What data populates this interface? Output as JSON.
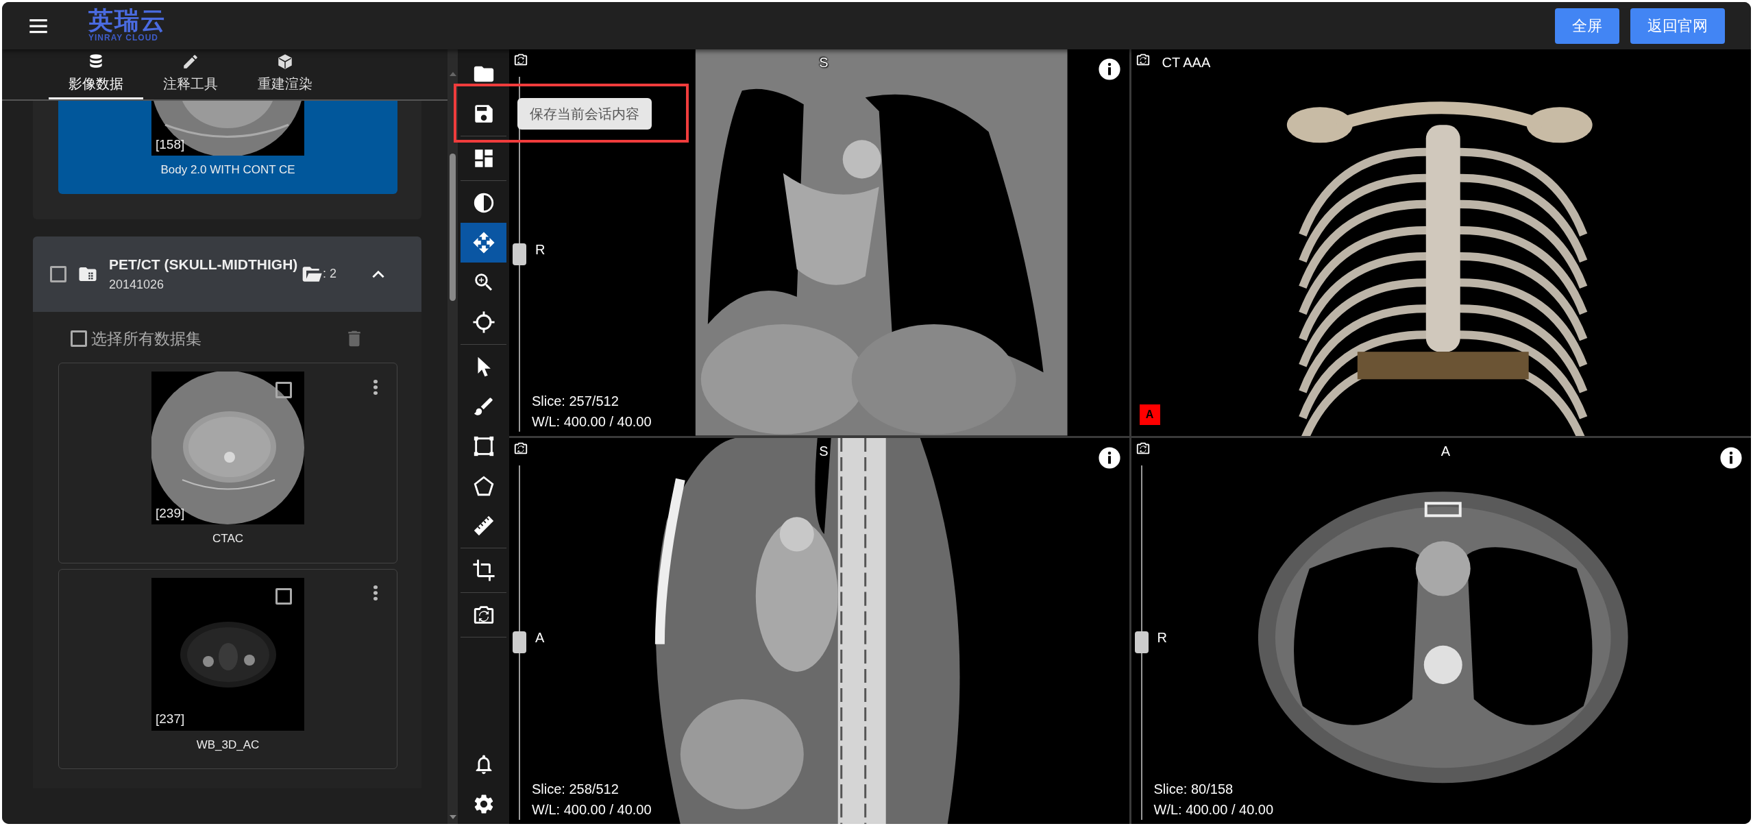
{
  "header": {
    "logo_text": "英瑞云",
    "logo_subtitle": "YINRAY CLOUD",
    "buttons": [
      "全屏",
      "返回官网"
    ]
  },
  "sidebar": {
    "tabs": [
      {
        "label": "影像数据",
        "kind": "database",
        "selected": true
      },
      {
        "label": "注释工具",
        "kind": "pencil",
        "selected": false
      },
      {
        "label": "重建渲染",
        "kind": "cube",
        "selected": false
      }
    ],
    "previous_series": {
      "count": "[158]",
      "name": "Body 2.0 WITH CONT CE",
      "selected": true
    },
    "study": {
      "title": "PET/CT (SKULL-MIDTHIGH)",
      "date": "20141026",
      "checked": false,
      "series_count": ": 2",
      "expanded": true,
      "select_all_label": "选择所有数据集",
      "select_all_checked": false,
      "series": [
        {
          "count": "[239]",
          "name": "CTAC",
          "kind": "ct",
          "checked": false,
          "selected": false
        },
        {
          "count": "[237]",
          "name": "WB_3D_AC",
          "kind": "pet",
          "checked": false,
          "selected": false
        }
      ]
    }
  },
  "toolbar": {
    "groups": [
      [
        {
          "kind": "open",
          "selected": false
        },
        {
          "kind": "save",
          "selected": false
        }
      ],
      [
        {
          "kind": "layout",
          "selected": false
        }
      ],
      [
        {
          "kind": "contrast",
          "selected": false
        },
        {
          "kind": "move",
          "selected": true
        },
        {
          "kind": "zoom",
          "selected": false
        },
        {
          "kind": "crosshair",
          "selected": false
        }
      ],
      [
        {
          "kind": "pointer",
          "selected": false
        },
        {
          "kind": "brush",
          "selected": false
        },
        {
          "kind": "rectangle",
          "selected": false
        },
        {
          "kind": "pentagon",
          "selected": false
        },
        {
          "kind": "ruler",
          "selected": false
        }
      ],
      [
        {
          "kind": "crop",
          "selected": false
        }
      ],
      [
        {
          "kind": "reset",
          "selected": false
        }
      ]
    ],
    "bottom": [
      {
        "kind": "bell",
        "selected": false
      },
      {
        "kind": "settings",
        "selected": false
      }
    ]
  },
  "tooltip": {
    "text": "保存当前会话内容",
    "highlighted": true
  },
  "viewports": [
    {
      "kind": "coronal",
      "top_label": "S",
      "side_label": "R",
      "slice": "Slice: 257/512",
      "window_level": "W/L: 400.00 / 40.00",
      "level": 0.5,
      "info": true
    },
    {
      "kind": "volume",
      "title": "CT AAA",
      "orientation_marker": "A"
    },
    {
      "kind": "sagittal",
      "top_label": "S",
      "side_label": "A",
      "slice": "Slice: 258/512",
      "window_level": "W/L: 400.00 / 40.00",
      "level": 0.5,
      "info": true
    },
    {
      "kind": "axial",
      "top_label": "A",
      "side_label": "R",
      "slice": "Slice: 80/158",
      "window_level": "W/L: 400.00 / 40.00",
      "level": 0.5,
      "info": true
    }
  ]
}
